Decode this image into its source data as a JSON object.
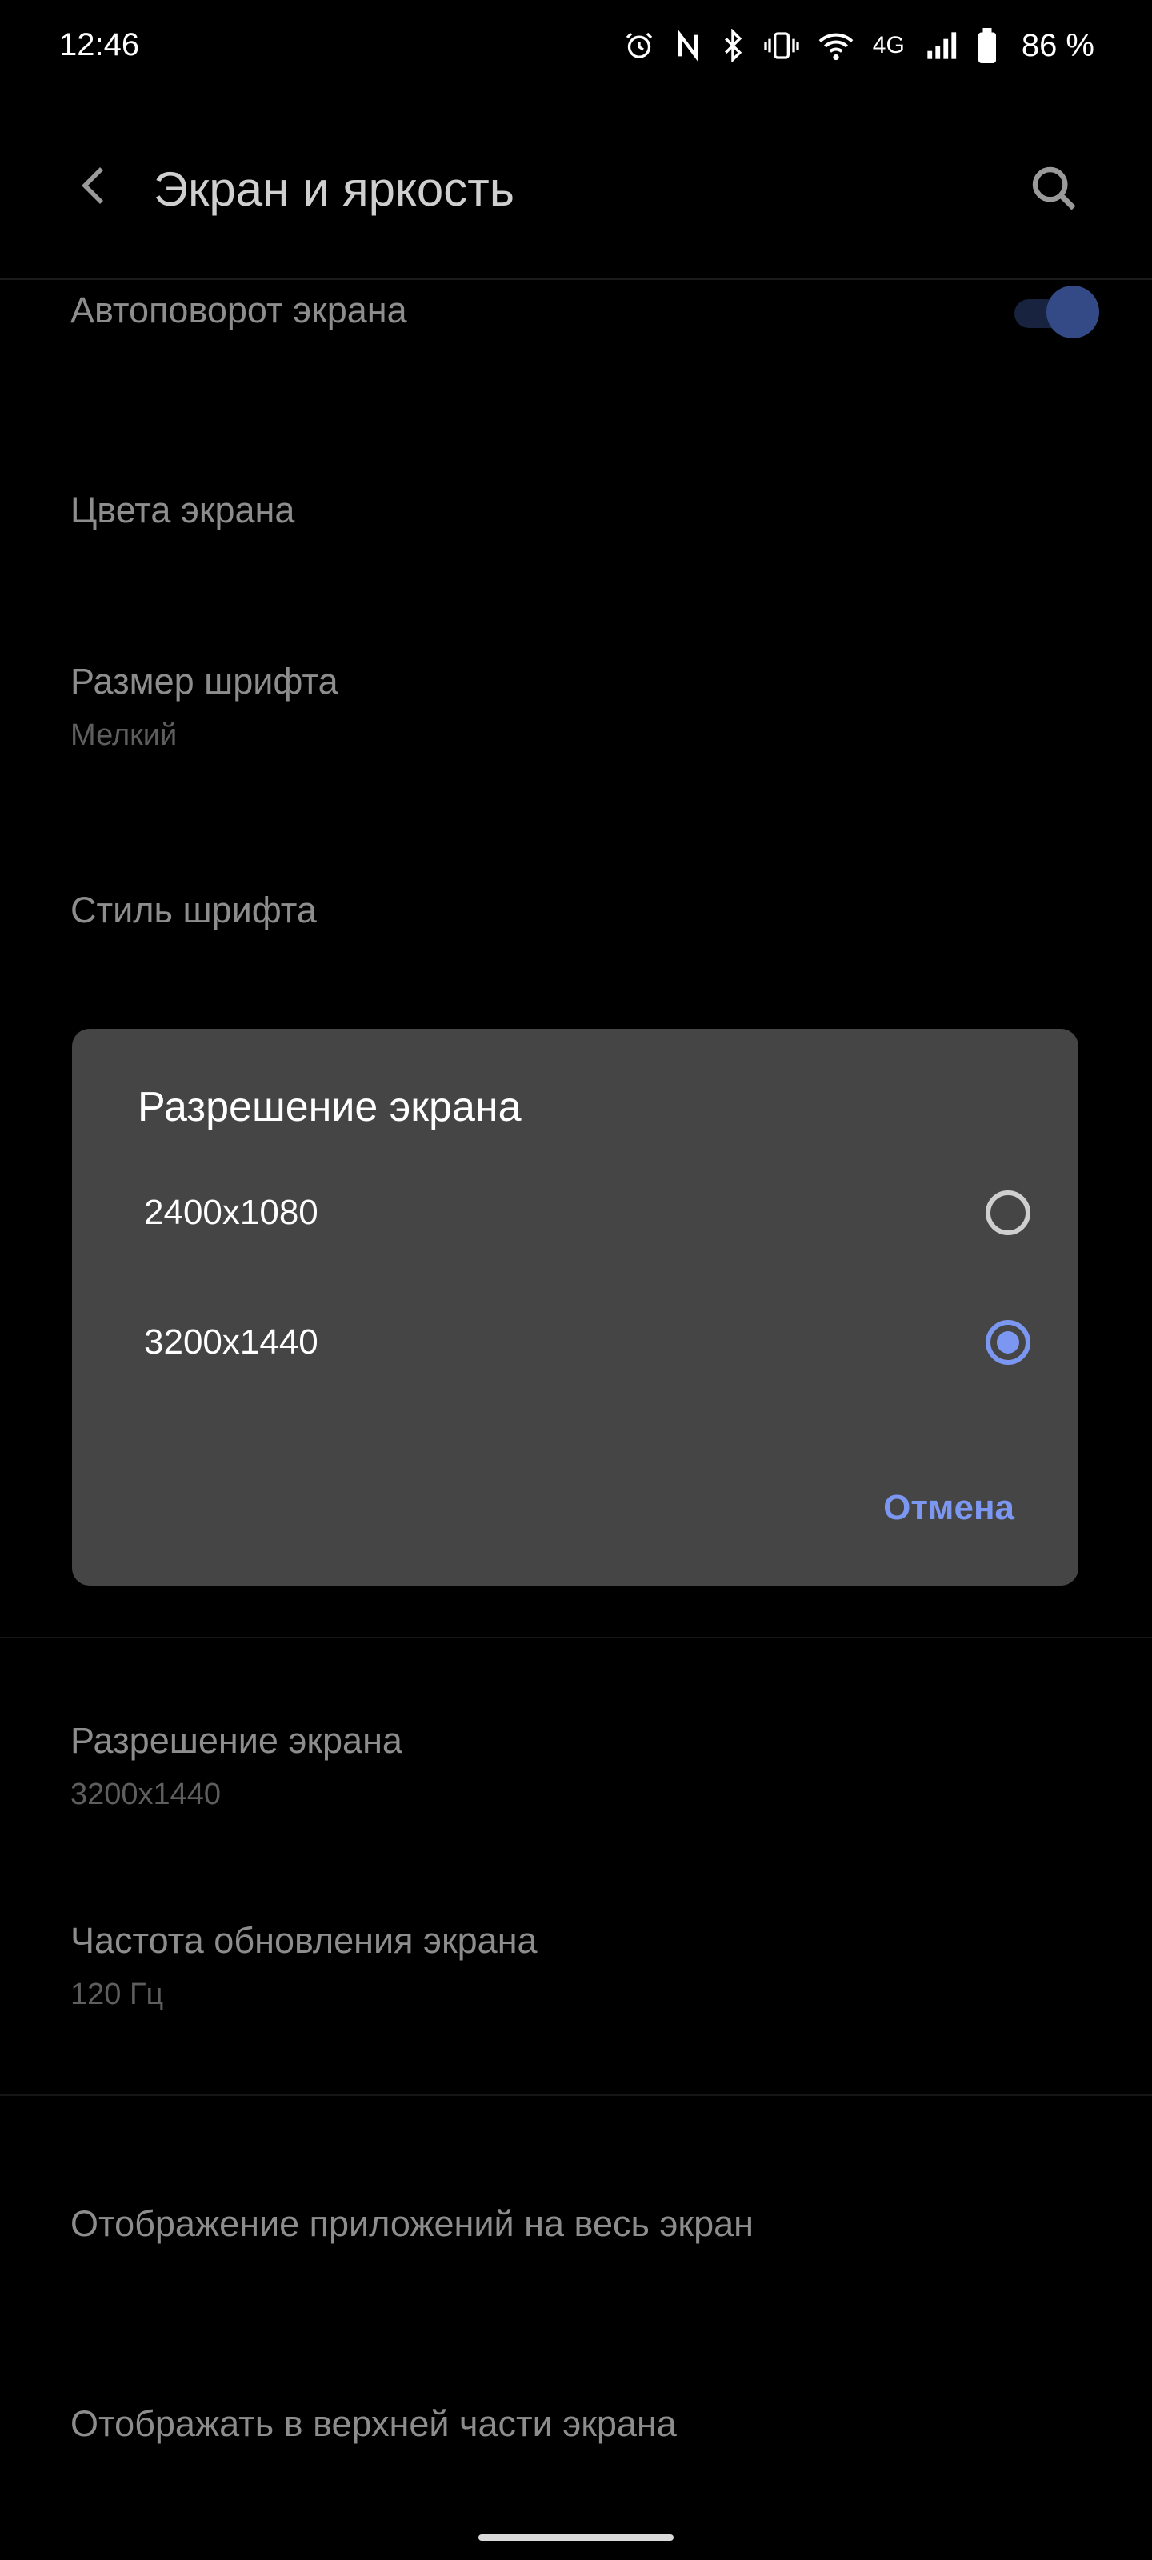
{
  "status_bar": {
    "time": "12:46",
    "battery_percent": "86 %",
    "icons": [
      "alarm-icon",
      "nfc-icon",
      "bluetooth-icon",
      "vibrate-icon",
      "wifi-icon",
      "network-4g-icon",
      "signal-icon",
      "battery-icon"
    ],
    "network_label": "4G"
  },
  "app_bar": {
    "title": "Экран и яркость",
    "back_icon": "back-arrow-icon",
    "search_icon": "search-icon"
  },
  "settings": {
    "auto_rotate": {
      "title": "Автоповорот экрана",
      "enabled": true
    },
    "screen_colors": {
      "title": "Цвета экрана"
    },
    "font_size": {
      "title": "Размер шрифта",
      "value": "Мелкий"
    },
    "font_style": {
      "title": "Стиль шрифта"
    },
    "resolution": {
      "title": "Разрешение экрана",
      "value": "3200x1440"
    },
    "refresh_rate": {
      "title": "Частота обновления экрана",
      "value": "120 Гц"
    },
    "fullscreen_apps": {
      "title": "Отображение приложений на весь экран"
    },
    "top_display": {
      "title": "Отображать в верхней части экрана"
    }
  },
  "dialog": {
    "title": "Разрешение экрана",
    "options": [
      {
        "label": "2400x1080",
        "selected": false
      },
      {
        "label": "3200x1440",
        "selected": true
      }
    ],
    "cancel_label": "Отмена"
  },
  "colors": {
    "accent": "#7b97f2",
    "dialog_bg": "#454545",
    "background": "#000000"
  }
}
